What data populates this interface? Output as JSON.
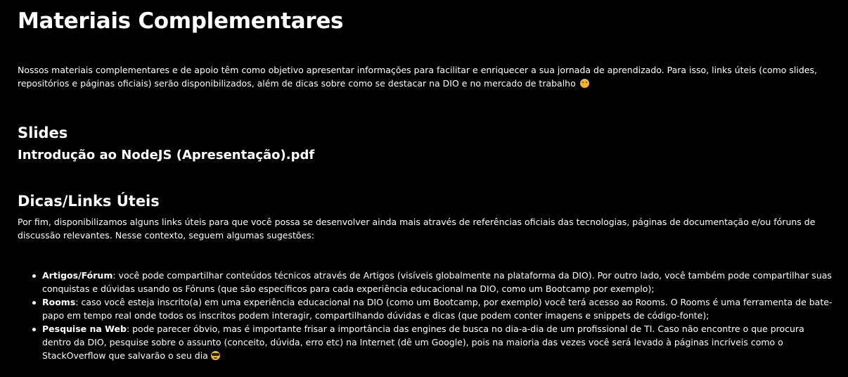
{
  "header": {
    "title": "Materiais Complementares"
  },
  "intro": {
    "text": "Nossos materiais complementares e de apoio têm como objetivo apresentar informações para facilitar e enriquecer a sua jornada de aprendizado. Para isso, links úteis (como slides, repositórios e páginas oficiais) serão disponibilizados, além de dicas sobre como se destacar na DIO e no mercado de trabalho",
    "emoji_icon": "blushing-smile-emoji-icon"
  },
  "slides": {
    "title": "Slides",
    "file_link": "Introdução ao NodeJS (Apresentação).pdf"
  },
  "tips": {
    "title": "Dicas/Links Úteis",
    "description": "Por fim, disponibilizamos alguns links úteis para que você possa se desenvolver ainda mais através de referências oficiais das tecnologias, páginas de documentação e/ou fóruns de discussão relevantes. Nesse contexto, seguem algumas sugestões:",
    "items": [
      {
        "term": "Artigos/Fórum",
        "text": ": você pode compartilhar conteúdos técnicos através de Artigos (visíveis globalmente na plataforma da DIO). Por outro lado, você também pode compartilhar suas conquistas e dúvidas usando os Fóruns (que são específicos para cada experiência educacional na DIO, como um Bootcamp por exemplo);"
      },
      {
        "term": "Rooms",
        "text": ": caso você esteja inscrito(a) em uma experiência educacional na DIO (como um Bootcamp, por exemplo) você terá acesso ao Rooms. O Rooms é uma ferramenta de bate-papo em tempo real onde todos os inscritos podem interagir, compartilhando dúvidas e dicas (que podem conter imagens e snippets de código-fonte);"
      },
      {
        "term": "Pesquise na Web",
        "text": ": pode parecer óbvio, mas é importante frisar a importância das engines de busca no dia-a-dia de um profissional de TI. Caso não encontre o que procura dentro da DIO, pesquise sobre o assunto (conceito, dúvida, erro etc) na Internet (dê um Google), pois na maioria das vezes você será levado à páginas incríveis como o StackOverflow que salvarão o seu dia",
        "emoji_icon": "sunglasses-emoji-icon"
      }
    ]
  },
  "colors": {
    "background": "#000000",
    "text": "#ffffff",
    "emoji": "#f3b33a"
  }
}
